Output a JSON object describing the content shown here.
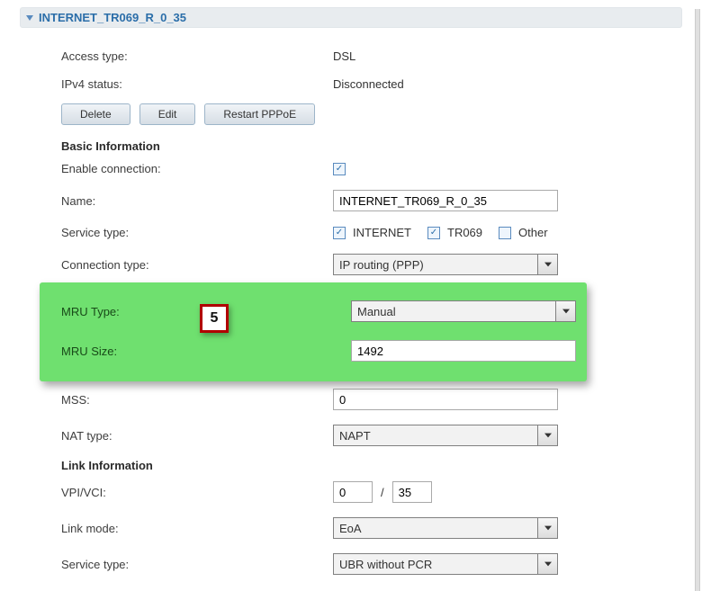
{
  "header": {
    "title": "INTERNET_TR069_R_0_35"
  },
  "info": {
    "access_type_label": "Access type:",
    "access_type_value": "DSL",
    "ipv4_status_label": "IPv4 status:",
    "ipv4_status_value": "Disconnected"
  },
  "buttons": {
    "delete": "Delete",
    "edit": "Edit",
    "restart": "Restart PPPoE"
  },
  "sections": {
    "basic": "Basic Information",
    "link": "Link Information"
  },
  "basic": {
    "enable_label": "Enable connection:",
    "name_label": "Name:",
    "name_value": "INTERNET_TR069_R_0_35",
    "service_type_label": "Service type:",
    "svc_internet": "INTERNET",
    "svc_tr069": "TR069",
    "svc_other": "Other",
    "conn_type_label": "Connection type:",
    "conn_type_value": "IP routing (PPP)",
    "mru_type_label": "MRU Type:",
    "mru_type_value": "Manual",
    "mru_size_label": "MRU Size:",
    "mru_size_value": "1492",
    "mss_label": "MSS:",
    "mss_value": "0",
    "nat_label": "NAT type:",
    "nat_value": "NAPT"
  },
  "link": {
    "vpivci_label": "VPI/VCI:",
    "vpi_value": "0",
    "vci_value": "35",
    "slash": "/",
    "link_mode_label": "Link mode:",
    "link_mode_value": "EoA",
    "service_type_label": "Service type:",
    "service_type_value": "UBR without PCR"
  },
  "callout": {
    "step": "5"
  }
}
